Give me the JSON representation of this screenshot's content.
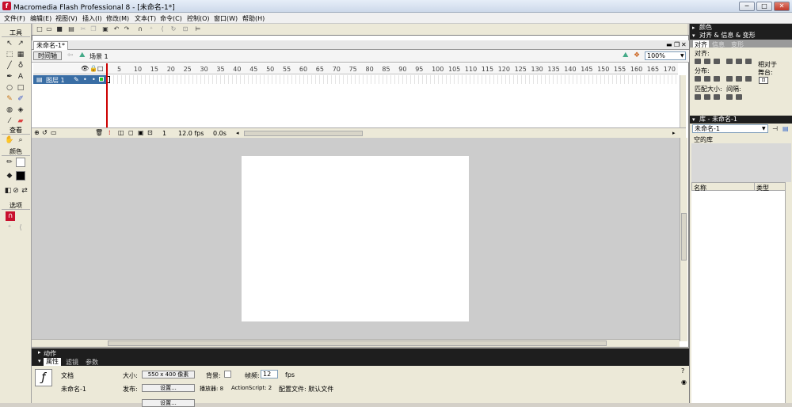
{
  "app": {
    "title": "Macromedia Flash Professional 8 - [未命名-1*]"
  },
  "menu": [
    "文件(F)",
    "编辑(E)",
    "视图(V)",
    "插入(I)",
    "修改(M)",
    "文本(T)",
    "命令(C)",
    "控制(O)",
    "窗口(W)",
    "帮助(H)"
  ],
  "tools": {
    "header": "工具",
    "view_header": "查看",
    "color_header": "颜色",
    "options_header": "选项"
  },
  "document": {
    "tab": "未命名-1*",
    "timeline_button": "时间轴",
    "scene": "场景 1",
    "zoom": "100%"
  },
  "timeline": {
    "layer": "图层 1",
    "ruler": [
      "5",
      "10",
      "15",
      "20",
      "25",
      "30",
      "35",
      "40",
      "45",
      "50",
      "55",
      "60",
      "65",
      "70",
      "75",
      "80",
      "85",
      "90",
      "95",
      "100",
      "105",
      "110",
      "115",
      "120",
      "125",
      "130",
      "135",
      "140",
      "145",
      "150",
      "155",
      "160",
      "165",
      "170"
    ],
    "frame": "1",
    "fps": "12.0 fps",
    "time": "0.0s"
  },
  "panels": {
    "actions": "动作",
    "tabs": [
      "属性",
      "滤镜",
      "参数"
    ],
    "props": {
      "type": "文档",
      "name": "未命名-1",
      "size_label": "大小:",
      "size_value": "550 x 400 像素",
      "bg_label": "背景:",
      "fps_label": "帧频:",
      "fps_value": "12",
      "fps_unit": "fps",
      "publish_label": "发布:",
      "settings_button": "设置...",
      "player": "播放器: 8",
      "actionscript": "ActionScript: 2",
      "profile": "配置文件: 默认文件"
    }
  },
  "right": {
    "color": "颜色",
    "align_header": "对齐 & 信息 & 变形",
    "align_tabs": [
      "对齐",
      "信息",
      "变形"
    ],
    "align_label": "对齐:",
    "distribute_label": "分布:",
    "match_label": "匹配大小:",
    "spacing_label": "间隔:",
    "stage_label": "相对于",
    "stage_label2": "舞台:",
    "library_header": "库 - 未命名-1",
    "library_select": "未命名-1",
    "empty": "空的库",
    "col_name": "名称",
    "col_type": "类型"
  }
}
